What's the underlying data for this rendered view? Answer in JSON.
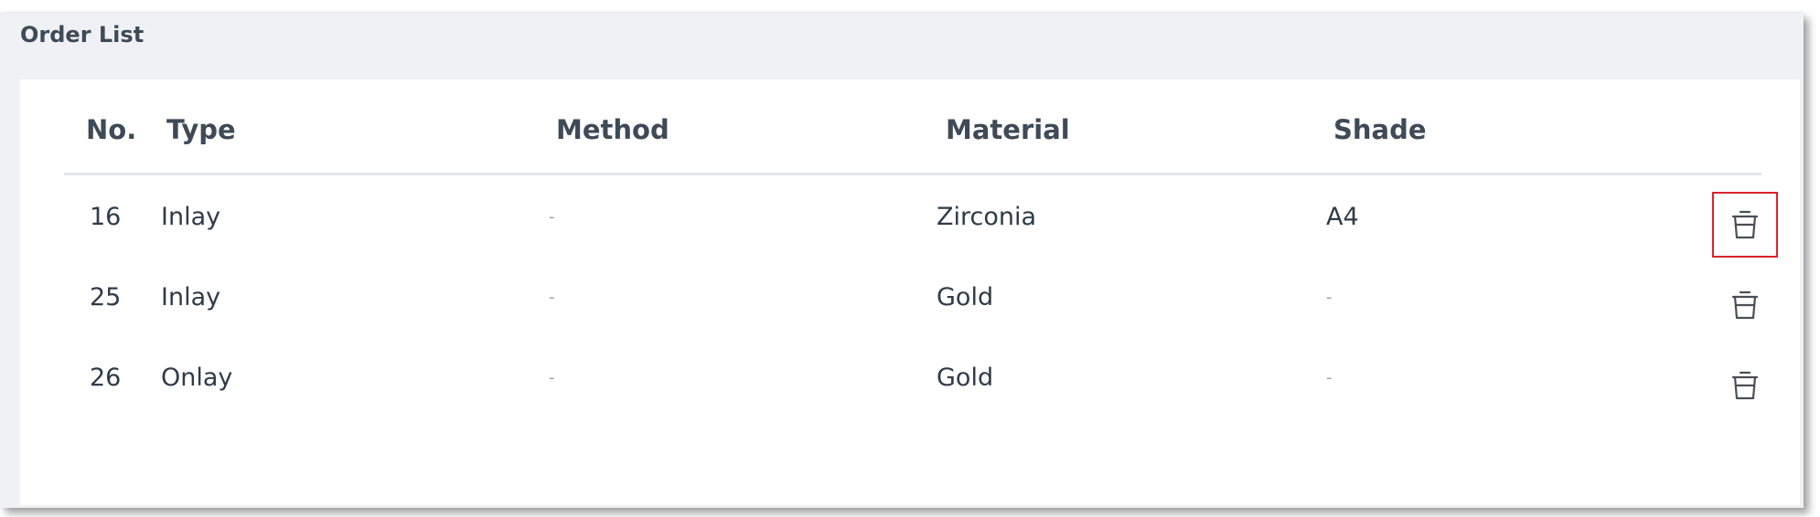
{
  "panel": {
    "title": "Order List"
  },
  "table": {
    "columns": {
      "no": "No.",
      "type": "Type",
      "method": "Method",
      "material": "Material",
      "shade": "Shade"
    },
    "rows": [
      {
        "no": "16",
        "type": "Inlay",
        "method": "-",
        "material": "Zirconia",
        "shade": "A4",
        "highlighted": true
      },
      {
        "no": "25",
        "type": "Inlay",
        "method": "-",
        "material": "Gold",
        "shade": "-",
        "highlighted": false
      },
      {
        "no": "26",
        "type": "Onlay",
        "method": "-",
        "material": "Gold",
        "shade": "-",
        "highlighted": false
      }
    ],
    "row_action_icon": "trash-icon"
  },
  "colors": {
    "highlight_border": "#d9242b",
    "panel_background": "#f0f1f5",
    "text": "#3e4a56"
  }
}
